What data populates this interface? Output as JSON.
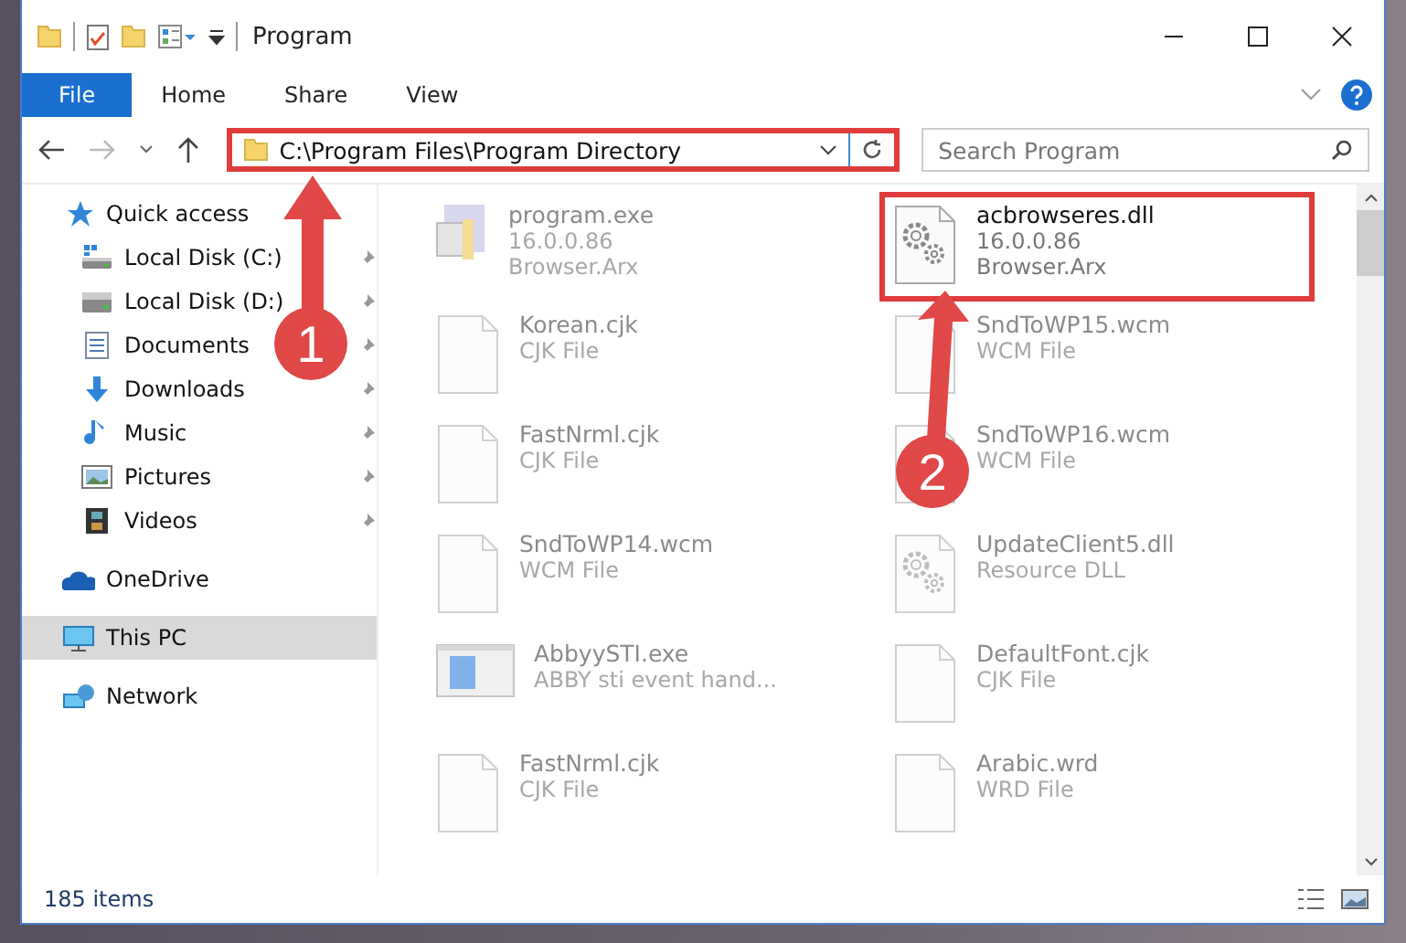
{
  "window": {
    "title": "Program"
  },
  "ribbon_tabs": [
    {
      "label": "File",
      "selected": true
    },
    {
      "label": "Home",
      "selected": false
    },
    {
      "label": "Share",
      "selected": false
    },
    {
      "label": "View",
      "selected": false
    }
  ],
  "address_bar": {
    "path": "C:\\Program Files\\Program Directory",
    "highlighted": true
  },
  "search": {
    "placeholder": "Search Program"
  },
  "sidebar": {
    "items": [
      {
        "label": "Quick access",
        "pinned": false,
        "selected": false
      },
      {
        "label": "Local Disk (C:)",
        "pinned": true,
        "selected": false
      },
      {
        "label": "Local Disk (D:)",
        "pinned": true,
        "selected": false
      },
      {
        "label": "Documents",
        "pinned": true,
        "selected": false
      },
      {
        "label": "Downloads",
        "pinned": true,
        "selected": false
      },
      {
        "label": "Music",
        "pinned": true,
        "selected": false
      },
      {
        "label": "Pictures",
        "pinned": true,
        "selected": false
      },
      {
        "label": "Videos",
        "pinned": true,
        "selected": false
      },
      {
        "label": "OneDrive",
        "pinned": false,
        "selected": false
      },
      {
        "label": "This PC",
        "pinned": false,
        "selected": true
      },
      {
        "label": "Network",
        "pinned": false,
        "selected": false
      }
    ]
  },
  "files": [
    {
      "name": "program.exe",
      "line2": "16.0.0.86",
      "line3": "Browser.Arx",
      "kind": "program",
      "blurred": true,
      "highlighted": false
    },
    {
      "name": "acbrowseres.dll",
      "line2": "16.0.0.86",
      "line3": "Browser.Arx",
      "kind": "settings",
      "blurred": false,
      "highlighted": true
    },
    {
      "name": "Korean.cjk",
      "line2": "CJK File",
      "kind": "document",
      "blurred": true,
      "highlighted": false
    },
    {
      "name": "SndToWP15.wcm",
      "line2": "WCM File",
      "kind": "document",
      "blurred": true,
      "highlighted": false
    },
    {
      "name": "FastNrml.cjk",
      "line2": "CJK File",
      "kind": "document",
      "blurred": true,
      "highlighted": false
    },
    {
      "name": "SndToWP16.wcm",
      "line2": "WCM File",
      "kind": "document",
      "blurred": true,
      "highlighted": false
    },
    {
      "name": "SndToWP14.wcm",
      "line2": "WCM File",
      "kind": "document",
      "blurred": true,
      "highlighted": false
    },
    {
      "name": "UpdateClient5.dll",
      "line2": "Resource DLL",
      "kind": "settings",
      "blurred": true,
      "highlighted": false
    },
    {
      "name": "AbbyySTI.exe",
      "line2": "ABBY sti event hand...",
      "kind": "window",
      "blurred": true,
      "highlighted": false
    },
    {
      "name": "DefaultFont.cjk",
      "line2": "CJK File",
      "kind": "document",
      "blurred": true,
      "highlighted": false
    },
    {
      "name": "FastNrml.cjk",
      "line2": "CJK File",
      "kind": "document",
      "blurred": true,
      "highlighted": false
    },
    {
      "name": "Arabic.wrd",
      "line2": "WRD File",
      "kind": "document",
      "blurred": true,
      "highlighted": false
    }
  ],
  "annotations": [
    {
      "label": "1"
    },
    {
      "label": "2"
    }
  ],
  "status_bar": {
    "count": "185 items"
  }
}
